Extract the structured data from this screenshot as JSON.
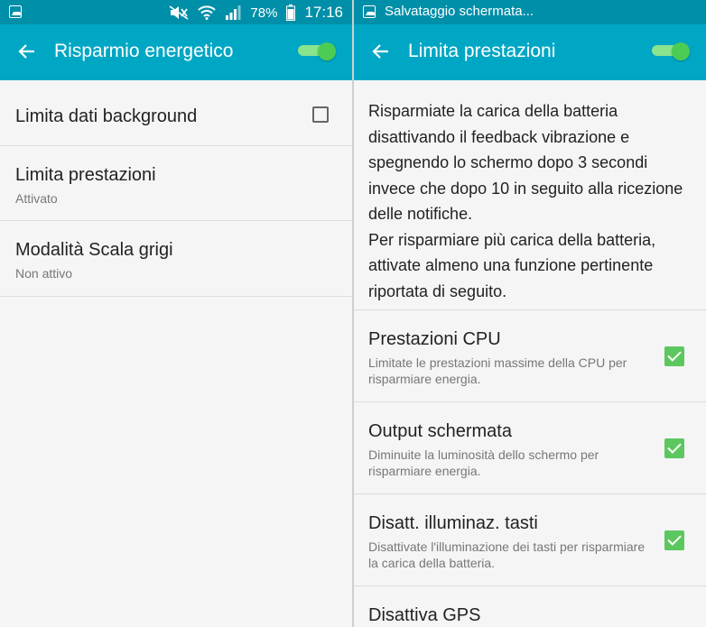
{
  "status_left": {
    "battery_percent": "78%",
    "time": "17:16"
  },
  "status_right": {
    "notification": "Salvataggio schermata..."
  },
  "left_screen": {
    "title": "Risparmio energetico",
    "toggle_on": true,
    "items": [
      {
        "title": "Limita dati background",
        "subtitle": "",
        "checked": false
      },
      {
        "title": "Limita prestazioni",
        "subtitle": "Attivato"
      },
      {
        "title": "Modalità Scala grigi",
        "subtitle": "Non attivo"
      }
    ]
  },
  "right_screen": {
    "title": "Limita prestazioni",
    "toggle_on": true,
    "description_1": "Risparmiate la carica della batteria disattivando il feedback vibrazione e spegnendo lo schermo dopo 3 secondi invece che dopo 10 in seguito alla ricezione delle notifiche.",
    "description_2": "Per risparmiare più carica della batteria, attivate almeno una funzione pertinente riportata di seguito.",
    "items": [
      {
        "title": "Prestazioni CPU",
        "subtitle": "Limitate le prestazioni massime della CPU per risparmiare energia.",
        "checked": true
      },
      {
        "title": "Output schermata",
        "subtitle": "Diminuite la luminosità dello schermo per risparmiare energia.",
        "checked": true
      },
      {
        "title": "Disatt. illuminaz. tasti",
        "subtitle": "Disattivate l'illuminazione dei tasti per risparmiare la carica della batteria.",
        "checked": true
      },
      {
        "title": "Disattiva GPS",
        "subtitle": ""
      }
    ]
  },
  "colors": {
    "status_bar": "#008fa8",
    "app_bar": "#00a7c4",
    "toggle_on": "#4dcc54",
    "checkbox_checked": "#5cc75f"
  }
}
